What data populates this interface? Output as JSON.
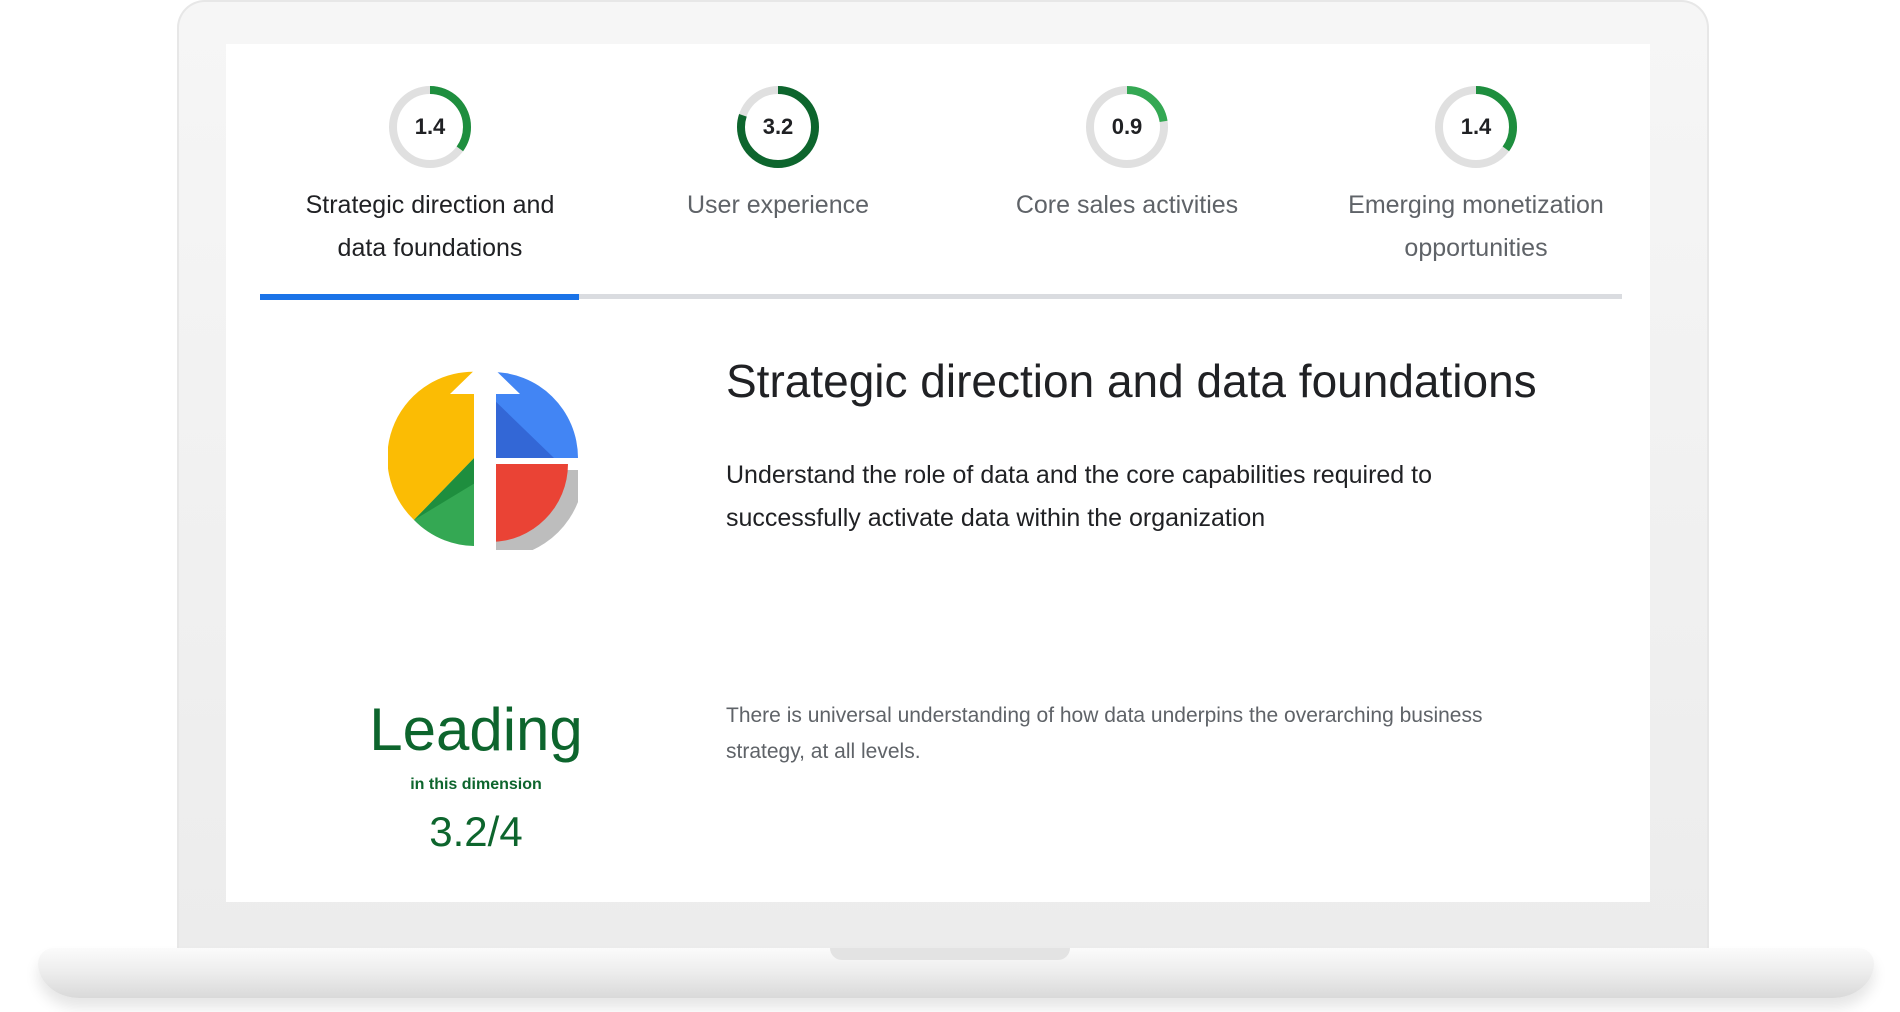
{
  "tabs": [
    {
      "score": "1.4",
      "fraction": 0.35,
      "label": "Strategic direction and data foundations",
      "active": true
    },
    {
      "score": "3.2",
      "fraction": 0.8,
      "label": "User experience",
      "active": false
    },
    {
      "score": "0.9",
      "fraction": 0.225,
      "label": "Core sales activities",
      "active": false
    },
    {
      "score": "1.4",
      "fraction": 0.35,
      "label": "Emerging monetization opportunities",
      "active": false
    }
  ],
  "colors": {
    "ring_track": "#e0e0e0",
    "ring_low": "#34a853",
    "ring_mid": "#1e8e3e",
    "ring_high": "#0d652d",
    "tab_indicator": "#1a73e8",
    "level_green": "#0d652d"
  },
  "section": {
    "title": "Strategic direction and data foundations",
    "description": "Understand the role of data and the core capabilities required to successfully activate data within the organization",
    "logo_icon": "pie-chart-arrow-icon"
  },
  "level": {
    "name": "Leading",
    "subtitle": "in this dimension",
    "score_text": "3.2/4",
    "score_fraction": 0.8,
    "description": "There is universal understanding of how data underpins the overarching business strategy, at all levels."
  }
}
